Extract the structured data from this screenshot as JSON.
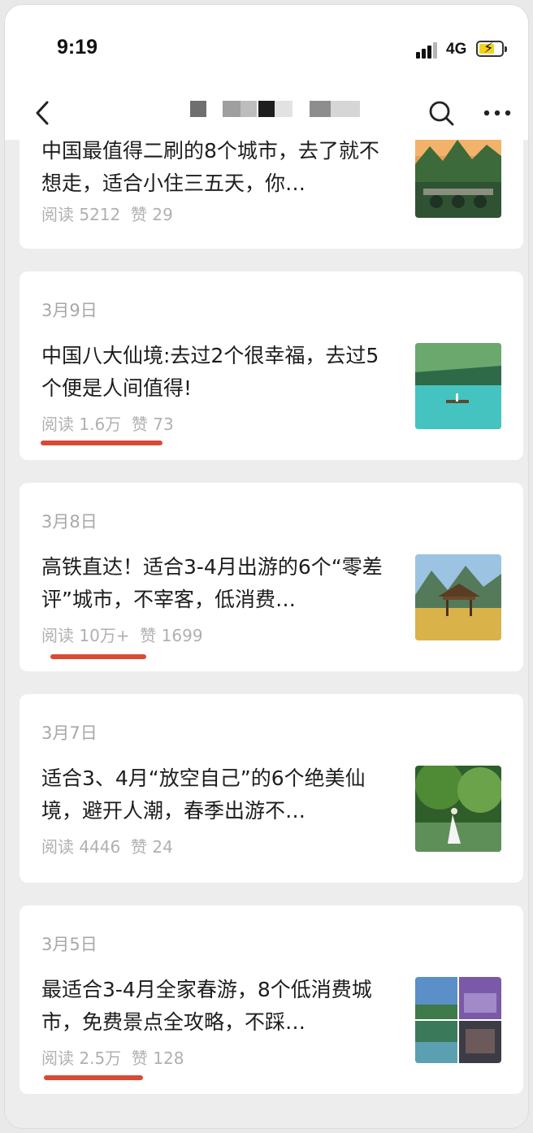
{
  "status_bar": {
    "time": "9:19",
    "network": "4G"
  },
  "nav": {
    "title": ""
  },
  "articles": [
    {
      "date": "",
      "title": "中国最值得二刷的8个城市，去了就不想走，适合小住三五天，你…",
      "read_label": "阅读",
      "read_count": "5212",
      "like_label": "赞",
      "like_count": "29"
    },
    {
      "date": "3月9日",
      "title": "中国八大仙境:去过2个很幸福，去过5个便是人间值得!",
      "read_label": "阅读",
      "read_count": "1.6万",
      "like_label": "赞",
      "like_count": "73"
    },
    {
      "date": "3月8日",
      "title": "高铁直达！适合3-4月出游的6个“零差评”城市，不宰客，低消费…",
      "read_label": "阅读",
      "read_count": "10万+",
      "like_label": "赞",
      "like_count": "1699"
    },
    {
      "date": "3月7日",
      "title": "适合3、4月“放空自己”的6个绝美仙境，避开人潮，春季出游不…",
      "read_label": "阅读",
      "read_count": "4446",
      "like_label": "赞",
      "like_count": "24"
    },
    {
      "date": "3月5日",
      "title": "最适合3-4月全家春游，8个低消费城市，免费景点全攻略，不踩…",
      "read_label": "阅读",
      "read_count": "2.5万",
      "like_label": "赞",
      "like_count": "128"
    }
  ],
  "colors": {
    "highlight_underline": "#d94a34",
    "meta_text": "#b0b0b0",
    "background": "#ededed"
  },
  "icons": [
    "back-icon",
    "search-icon",
    "more-icon",
    "signal-icon",
    "battery-icon"
  ]
}
